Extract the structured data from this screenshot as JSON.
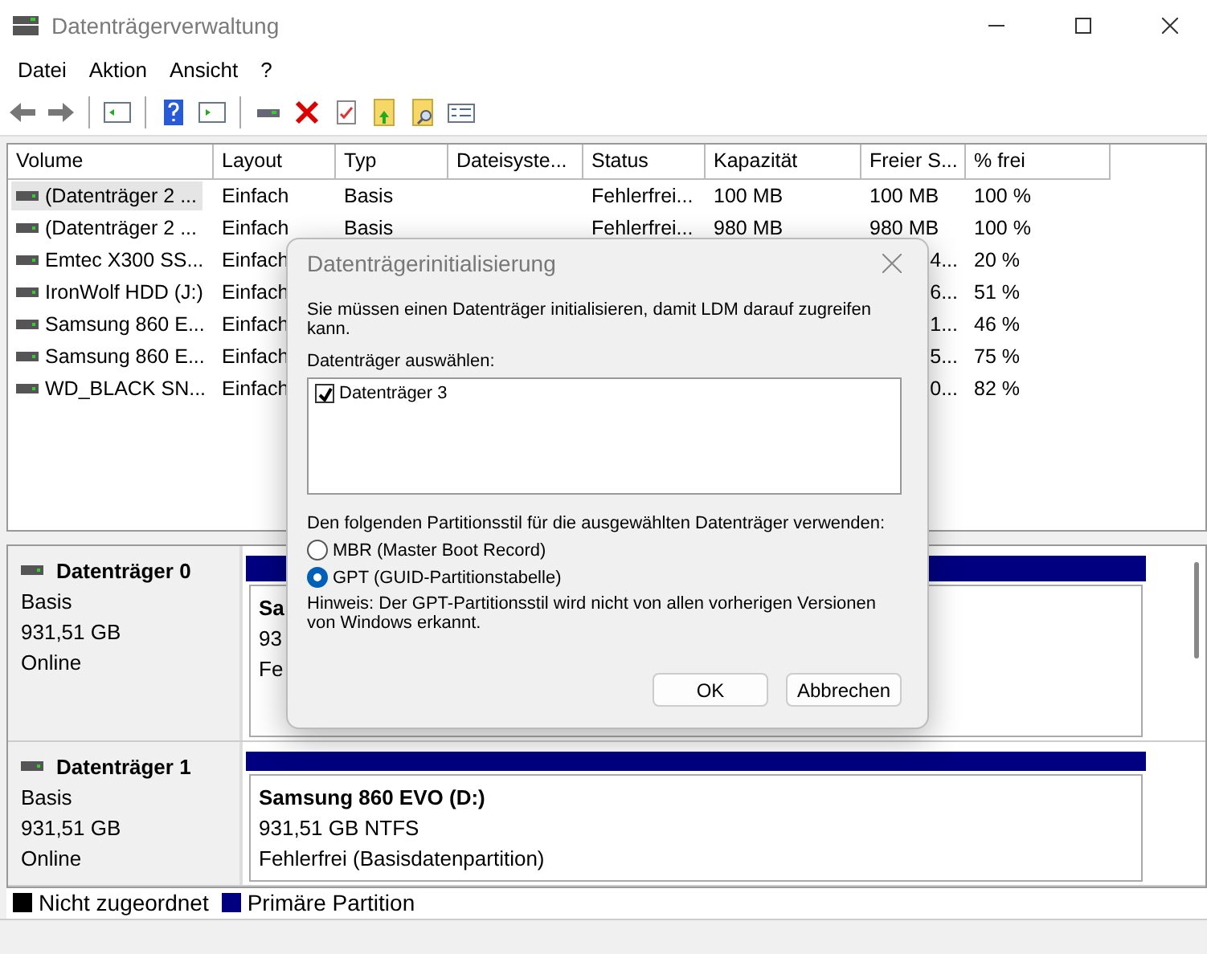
{
  "window": {
    "title": "Datenträgerverwaltung"
  },
  "menu": [
    "Datei",
    "Aktion",
    "Ansicht",
    "?"
  ],
  "table": {
    "columns": [
      "Volume",
      "Layout",
      "Typ",
      "Dateisyste...",
      "Status",
      "Kapazität",
      "Freier S...",
      "% frei"
    ],
    "rows": [
      {
        "selected": true,
        "cells": [
          "(Datenträger 2 ...",
          "Einfach",
          "Basis",
          "",
          "Fehlerfrei...",
          "100 MB",
          "100 MB",
          "100 %"
        ]
      },
      {
        "selected": false,
        "cells": [
          "(Datenträger 2 ...",
          "Einfach",
          "Basis",
          "",
          "Fehlerfrei...",
          "980 MB",
          "980 MB",
          "100 %"
        ]
      },
      {
        "selected": false,
        "cells": [
          "Emtec X300 SS...",
          "Einfach",
          "",
          "",
          "",
          "",
          "4...",
          "20 %"
        ]
      },
      {
        "selected": false,
        "cells": [
          "IronWolf HDD (J:)",
          "Einfach",
          "",
          "",
          "",
          "",
          "6...",
          "51 %"
        ]
      },
      {
        "selected": false,
        "cells": [
          "Samsung 860 E...",
          "Einfach",
          "",
          "",
          "",
          "",
          "1...",
          "46 %"
        ]
      },
      {
        "selected": false,
        "cells": [
          "Samsung 860 E...",
          "Einfach",
          "",
          "",
          "",
          "",
          "5...",
          "75 %"
        ]
      },
      {
        "selected": false,
        "cells": [
          "WD_BLACK SN...",
          "Einfach",
          "",
          "",
          "",
          "",
          "0...",
          "82 %"
        ]
      }
    ]
  },
  "disks": [
    {
      "name": "Datenträger 0",
      "lines": [
        "Basis",
        "931,51 GB",
        "Online"
      ],
      "partition": {
        "title": "Sa",
        "lines": [
          "93",
          "Fe"
        ]
      }
    },
    {
      "name": "Datenträger 1",
      "lines": [
        "Basis",
        "931,51 GB",
        "Online"
      ],
      "partition": {
        "title": "Samsung 860 EVO  (D:)",
        "lines": [
          "931,51 GB NTFS",
          "Fehlerfrei (Basisdatenpartition)"
        ]
      }
    }
  ],
  "legend": [
    {
      "label": "Nicht zugeordnet",
      "color": "#000000"
    },
    {
      "label": "Primäre Partition",
      "color": "#000080"
    }
  ],
  "dialog": {
    "title": "Datenträgerinitialisierung",
    "intro": "Sie müssen einen Datenträger initialisieren, damit LDM darauf zugreifen kann.",
    "select_label": "Datenträger auswählen:",
    "disks": [
      {
        "label": "Datenträger 3",
        "checked": true
      }
    ],
    "style_label": "Den folgenden Partitionsstil für die ausgewählten Datenträger verwenden:",
    "options": [
      {
        "label": "MBR (Master Boot Record)",
        "selected": false
      },
      {
        "label": "GPT (GUID-Partitionstabelle)",
        "selected": true
      }
    ],
    "note": "Hinweis: Der GPT-Partitionsstil wird nicht von allen vorherigen Versionen von Windows erkannt.",
    "buttons": [
      "OK",
      "Abbrechen"
    ]
  }
}
